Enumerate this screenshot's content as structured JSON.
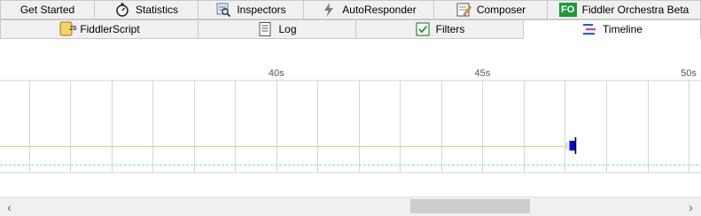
{
  "tabs_row1": [
    {
      "label": "Get Started",
      "icon": "none"
    },
    {
      "label": "Statistics",
      "icon": "stopwatch-icon"
    },
    {
      "label": "Inspectors",
      "icon": "inspector-icon"
    },
    {
      "label": "AutoResponder",
      "icon": "lightning-icon"
    },
    {
      "label": "Composer",
      "icon": "composer-icon"
    },
    {
      "label": "Fiddler Orchestra Beta",
      "icon": "fo-icon",
      "icon_text": "FO"
    }
  ],
  "tabs_row2": [
    {
      "label": "FiddlerScript",
      "icon": "script-icon",
      "icon_text": "JS"
    },
    {
      "label": "Log",
      "icon": "log-icon"
    },
    {
      "label": "Filters",
      "icon": "checkbox-icon"
    },
    {
      "label": "Timeline",
      "icon": "timeline-icon",
      "selected": true
    }
  ],
  "timeline": {
    "tick_labels": [
      "40s",
      "45s",
      "50s"
    ],
    "tick_values": [
      40,
      45,
      50
    ],
    "view_start_seconds": 33.3,
    "view_end_seconds": 50.3,
    "session_bar": {
      "start_seconds": 47.0,
      "end_seconds": 47.2
    },
    "colors": {
      "gridline": "#d6d6d6",
      "baseline": "#c8d9a6",
      "dashed": "#87d7dc",
      "bar": "#0000ff"
    }
  },
  "scrollbar": {
    "left_arrow": "‹",
    "right_arrow": "›",
    "thumb_start_fraction": 0.59,
    "thumb_end_fraction": 0.77
  }
}
